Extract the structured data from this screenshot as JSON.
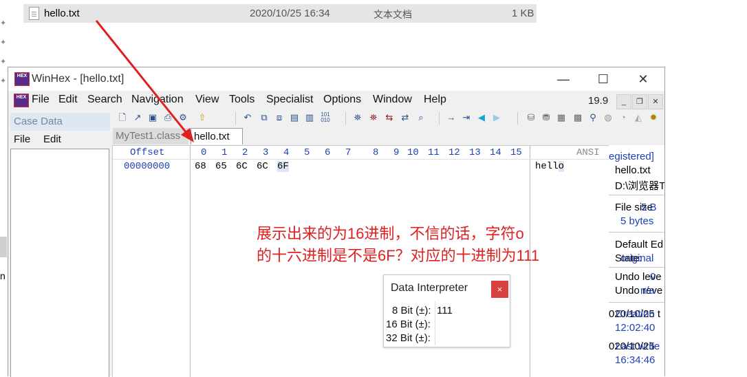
{
  "explorer": {
    "file_icon": "text-file-icon",
    "file_name": "hello.txt",
    "modified": "2020/10/25 16:34",
    "type": "文本文档",
    "size": "1 KB",
    "pin_icon": "pin-icon",
    "partial_letter": "n"
  },
  "window": {
    "title": "WinHex - [hello.txt]",
    "app_icon_text": "HEX",
    "min": "—",
    "max": "☐",
    "close": "✕"
  },
  "menu": {
    "items": [
      "File",
      "Edit",
      "Search",
      "Navigation",
      "View",
      "Tools",
      "Specialist",
      "Options",
      "Window",
      "Help"
    ],
    "version": "19.9",
    "mdi_min": "_",
    "mdi_restore": "❐",
    "mdi_close": "✕"
  },
  "toolbar": {
    "icons": [
      "new-icon",
      "open-icon",
      "save-icon",
      "print-icon",
      "properties-icon",
      "export-icon",
      "undo-icon",
      "copy-icon",
      "cut-icon",
      "paste-icon",
      "paste-special-icon",
      "hex-convert-icon",
      "find-icon",
      "find-hex-icon",
      "replace-icon",
      "replace-hex-icon",
      "find-text-icon",
      "goto-icon",
      "goto-offset-icon",
      "back-icon",
      "forward-icon",
      "disk-icon",
      "open-disk-icon",
      "ram-icon",
      "calculator-icon",
      "zoom-icon",
      "binoculars-icon",
      "chart-icon",
      "gear-icon",
      "settings-icon"
    ]
  },
  "case": {
    "title": "Case Data",
    "menu_file": "File",
    "menu_edit": "Edit"
  },
  "tabs": [
    {
      "label": "MyTest1.class",
      "active": false
    },
    {
      "label": "hello.txt",
      "active": true
    }
  ],
  "hex": {
    "offset_header": "Offset",
    "columns": [
      "0",
      "1",
      "2",
      "3",
      "4",
      "5",
      "6",
      "7",
      "8",
      "9",
      "10",
      "11",
      "12",
      "13",
      "14",
      "15"
    ],
    "ansi_header": "ANSI",
    "offset": "00000000",
    "bytes": [
      "68",
      "65",
      "6C",
      "6C",
      "6F"
    ],
    "ansi": "hello",
    "selected_index": 4
  },
  "info": {
    "registered": "egistered]",
    "file_name": "hello.txt",
    "path": "D:\\浏览器T",
    "file_size_label": "File size",
    "file_size_overlap": "5 B",
    "file_size_bytes": "5 bytes",
    "default_edit": "Default Ed",
    "state_a": "State:",
    "state_b": "original",
    "undo_level": "Undo leve",
    "undo_level_val": "0",
    "undo_reverse": "Undo reve",
    "undo_reverse_val": "n/a",
    "created_a": "020/10/25 t",
    "created_b": "Creation",
    "created_time": "12:02:40",
    "written_a": "020/10/25",
    "written_b": "Last write",
    "written_time": "16:34:46"
  },
  "annotation": {
    "line1": "展示出来的为16进制，不信的话，字符o",
    "line2": "的十六进制是不是6F？对应的十进制为111",
    "color": "#e02020"
  },
  "interpreter": {
    "title": "Data Interpreter",
    "close": "×",
    "rows": [
      {
        "label": "8 Bit (±):",
        "value": "111"
      },
      {
        "label": "16 Bit (±):",
        "value": ""
      },
      {
        "label": "32 Bit (±):",
        "value": ""
      }
    ]
  }
}
